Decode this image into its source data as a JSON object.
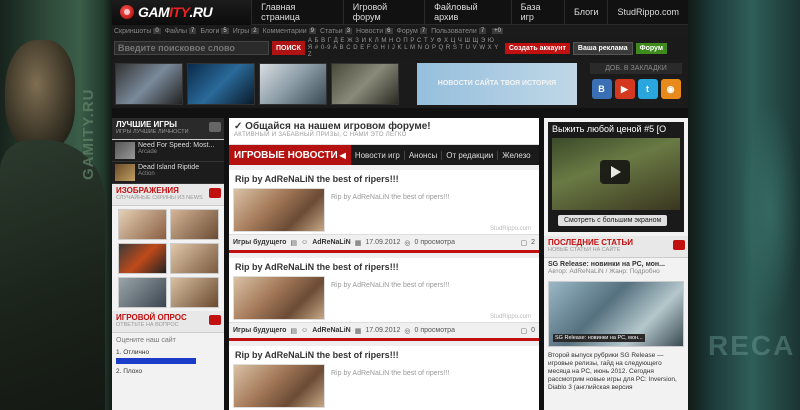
{
  "logo": {
    "text_main": "GAM",
    "text_accent": "ITY",
    "text_end": ".RU"
  },
  "nav": [
    "Главная страница",
    "Игровой форум",
    "Файловый архив",
    "База игр",
    "Блоги",
    "StudRippo.com"
  ],
  "stats": [
    {
      "label": "Скриншоты",
      "count": "0"
    },
    {
      "label": "Файлы",
      "count": "7"
    },
    {
      "label": "Блоги",
      "count": "5"
    },
    {
      "label": "Игры",
      "count": "2"
    },
    {
      "label": "Комментарии",
      "count": "9"
    },
    {
      "label": "Статьи",
      "count": "3"
    },
    {
      "label": "Новости",
      "count": "6"
    },
    {
      "label": "Форум",
      "count": "7"
    },
    {
      "label": "Пользователи",
      "count": "7"
    },
    {
      "label": "",
      "count": "+0"
    }
  ],
  "search": {
    "placeholder": "Введите поисковое слово",
    "button": "ПОИСК"
  },
  "alphabet": "А Б В Г Д Е Ж З И К Л М Н О П Р С Т У Ф Х Ц Ч Ш Щ Э Ю Я # 0-9 A B C D E F G H I J K L M N O P Q R S T U V W X Y Z",
  "header_buttons": {
    "create": "Создать аккаунт",
    "ad": "Ваша реклама",
    "forum": "Форум"
  },
  "banner": {
    "ad_text": "НОВОСТИ САЙТА ТВОЯ ИСТОРИЯ",
    "bookmark": "ДОБ. В ЗАКЛАДКИ"
  },
  "social": [
    {
      "icon": "vk-icon",
      "glyph": "B",
      "color": "#3a6fb5"
    },
    {
      "icon": "youtube-icon",
      "glyph": "▶",
      "color": "#d4391f"
    },
    {
      "icon": "twitter-icon",
      "glyph": "t",
      "color": "#29a6de"
    },
    {
      "icon": "rss-icon",
      "glyph": "◉",
      "color": "#e8891c"
    }
  ],
  "left": {
    "games": {
      "title": "ЛУЧШИЕ ИГРЫ",
      "subtitle": "ИГРЫ ЛУЧШИЕ ЛИЧНОСТИ"
    },
    "game_items": [
      {
        "name": "Need For Speed: Most...",
        "genre": "Arcade"
      },
      {
        "name": "Dead Island Riptide",
        "genre": "Action"
      }
    ],
    "images": {
      "title": "ИЗОБРАЖЕНИЯ",
      "subtitle": "СЛУЧАЙНЫЕ СКРИНЫ ИЗ NEWS"
    },
    "poll": {
      "title": "ИГРОВОЙ ОПРОС",
      "subtitle": "ОТВЕТЬТЕ НА ВОПРОС",
      "question": "Оцените наш сайт",
      "options": [
        "1. Отлично",
        "2. Плохо"
      ]
    }
  },
  "mid": {
    "forum": {
      "title": "Общайся на нашем игровом форуме!",
      "subtitle": "АКТИВНЫЙ И ЗАБАВНЫЙ ПРИЗЫ, С НАМИ ЭТО ЛЕГКО"
    },
    "news_title": "ИГРОВЫЕ НОВОСТИ",
    "news_tabs": [
      "Новости игр",
      "Анонсы",
      "От редакции",
      "Железо"
    ],
    "posts": [
      {
        "title": "Rip by AdReNaLiN the best of ripers!!!",
        "text": "Rip by AdReNaLiN the best of ripers!!!",
        "source": "StudRippo.com",
        "category": "Игры будущего",
        "author": "AdReNaLiN",
        "date": "17.09.2012",
        "views": "0 просмотра",
        "comments": "2"
      },
      {
        "title": "Rip by AdReNaLiN the best of ripers!!!",
        "text": "Rip by AdReNaLiN the best of ripers!!!",
        "source": "StudRippo.com",
        "category": "Игры будущего",
        "author": "AdReNaLiN",
        "date": "17.09.2012",
        "views": "0 просмотра",
        "comments": "0"
      },
      {
        "title": "Rip by AdReNaLiN the best of ripers!!!",
        "text": "Rip by AdReNaLiN the best of ripers!!!",
        "source": "",
        "category": "",
        "author": "",
        "date": "",
        "views": "",
        "comments": ""
      }
    ]
  },
  "right": {
    "video": {
      "title": "Выжить любой ценой #5 [O",
      "button": "Смотреть с большим экраном"
    },
    "articles": {
      "title": "ПОСЛЕДНИЕ СТАТЬИ",
      "subtitle": "НОВЫЕ СТАТЬИ НА САЙТЕ"
    },
    "article": {
      "title": "SG Release: новинки на PC, мон...",
      "meta": "Автор: AdReNaLiN / Жанр: Подробно",
      "image_caption": "SG Release: новинки на PC, мон...",
      "desc": "Второй выпуск рубрики SG Release — игровые релизы, гайд на следующего месяца на PC, июнь 2012. Сегодня рассмотрим новые игры для PC: Inversion, Diablo 3 (английская версия"
    }
  },
  "background": {
    "left_text": "GAMITY.RU",
    "right_text": "RECA"
  }
}
